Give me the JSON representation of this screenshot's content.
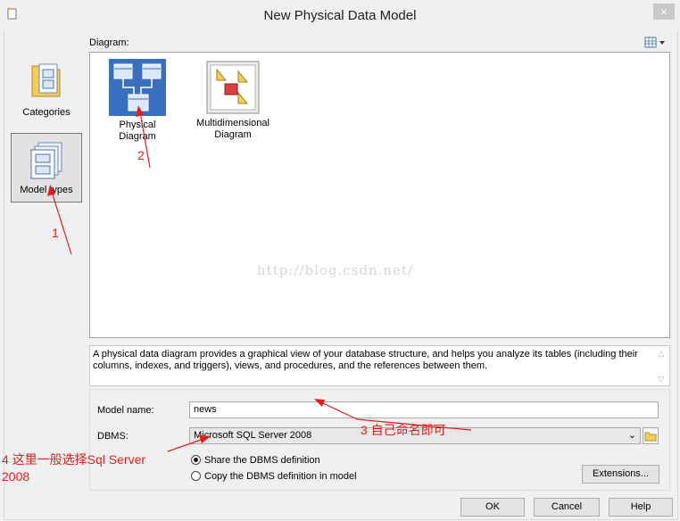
{
  "window": {
    "title": "New Physical Data Model",
    "close_label": "×"
  },
  "sidebar": {
    "items": [
      {
        "label": "Categories",
        "selected": false
      },
      {
        "label": "Model types",
        "selected": true
      }
    ]
  },
  "diagram": {
    "label": "Diagram:",
    "tiles": [
      {
        "label": "Physical Diagram",
        "selected": true
      },
      {
        "label": "Multidimensional Diagram",
        "selected": false
      }
    ],
    "watermark": "http://blog.csdn.net/"
  },
  "description": "A physical data diagram provides a graphical view of your database structure, and helps you analyze its tables (including their columns, indexes, and triggers), views, and procedures, and the references between them.",
  "form": {
    "model_name_label": "Model name:",
    "model_name_value": "news",
    "dbms_label": "DBMS:",
    "dbms_value": "Microsoft SQL Server 2008",
    "radio_share": "Share the DBMS definition",
    "radio_copy": "Copy the DBMS definition in model",
    "selected_radio": "share"
  },
  "buttons": {
    "extensions": "Extensions...",
    "ok": "OK",
    "cancel": "Cancel",
    "help": "Help"
  },
  "annotations": {
    "n1": "1",
    "n2": "2",
    "n3": "3 自己命名即可",
    "n4": "4 这里一般选择Sql Server 2008"
  },
  "colors": {
    "annotation": "#e02020",
    "selection": "#3a6fc0"
  }
}
